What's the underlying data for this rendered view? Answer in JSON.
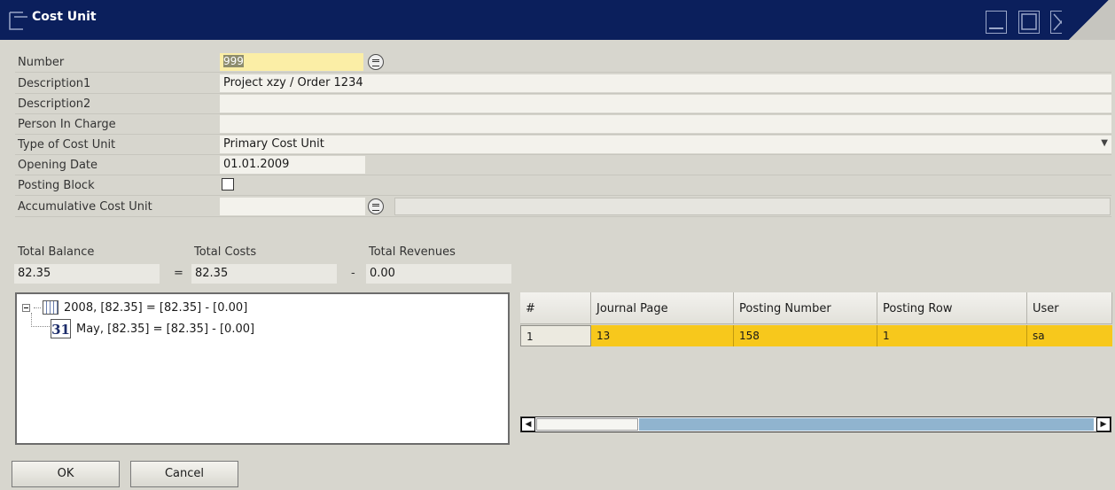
{
  "window": {
    "title": "Cost Unit"
  },
  "form": {
    "number": {
      "label": "Number",
      "value": "999"
    },
    "description1": {
      "label": "Description1",
      "value": "Project xzy / Order 1234"
    },
    "description2": {
      "label": "Description2",
      "value": ""
    },
    "person_in_charge": {
      "label": "Person In Charge",
      "value": ""
    },
    "type_of_cost_unit": {
      "label": "Type of Cost Unit",
      "value": "Primary Cost Unit"
    },
    "opening_date": {
      "label": "Opening Date",
      "value": "01.01.2009"
    },
    "posting_block": {
      "label": "Posting Block",
      "checked": false
    },
    "accumulative_cost_unit": {
      "label": "Accumulative Cost Unit",
      "value": "",
      "description": ""
    }
  },
  "totals": {
    "balance_label": "Total Balance",
    "balance": "82.35",
    "costs_label": "Total Costs",
    "costs": "82.35",
    "revenues_label": "Total Revenues",
    "revenues": "0.00",
    "equals": "=",
    "minus": "-"
  },
  "tree": {
    "year": {
      "text": "2008, [82.35] = [82.35] - [0.00]"
    },
    "month": {
      "text": "May, [82.35] = [82.35] - [0.00]",
      "icon_text": "31"
    }
  },
  "grid": {
    "headers": [
      "#",
      "Journal Page",
      "Posting Number",
      "Posting Row",
      "User"
    ],
    "rows": [
      [
        "1",
        "13",
        "158",
        "1",
        "sa"
      ]
    ]
  },
  "buttons": {
    "ok": "OK",
    "cancel": "Cancel"
  }
}
